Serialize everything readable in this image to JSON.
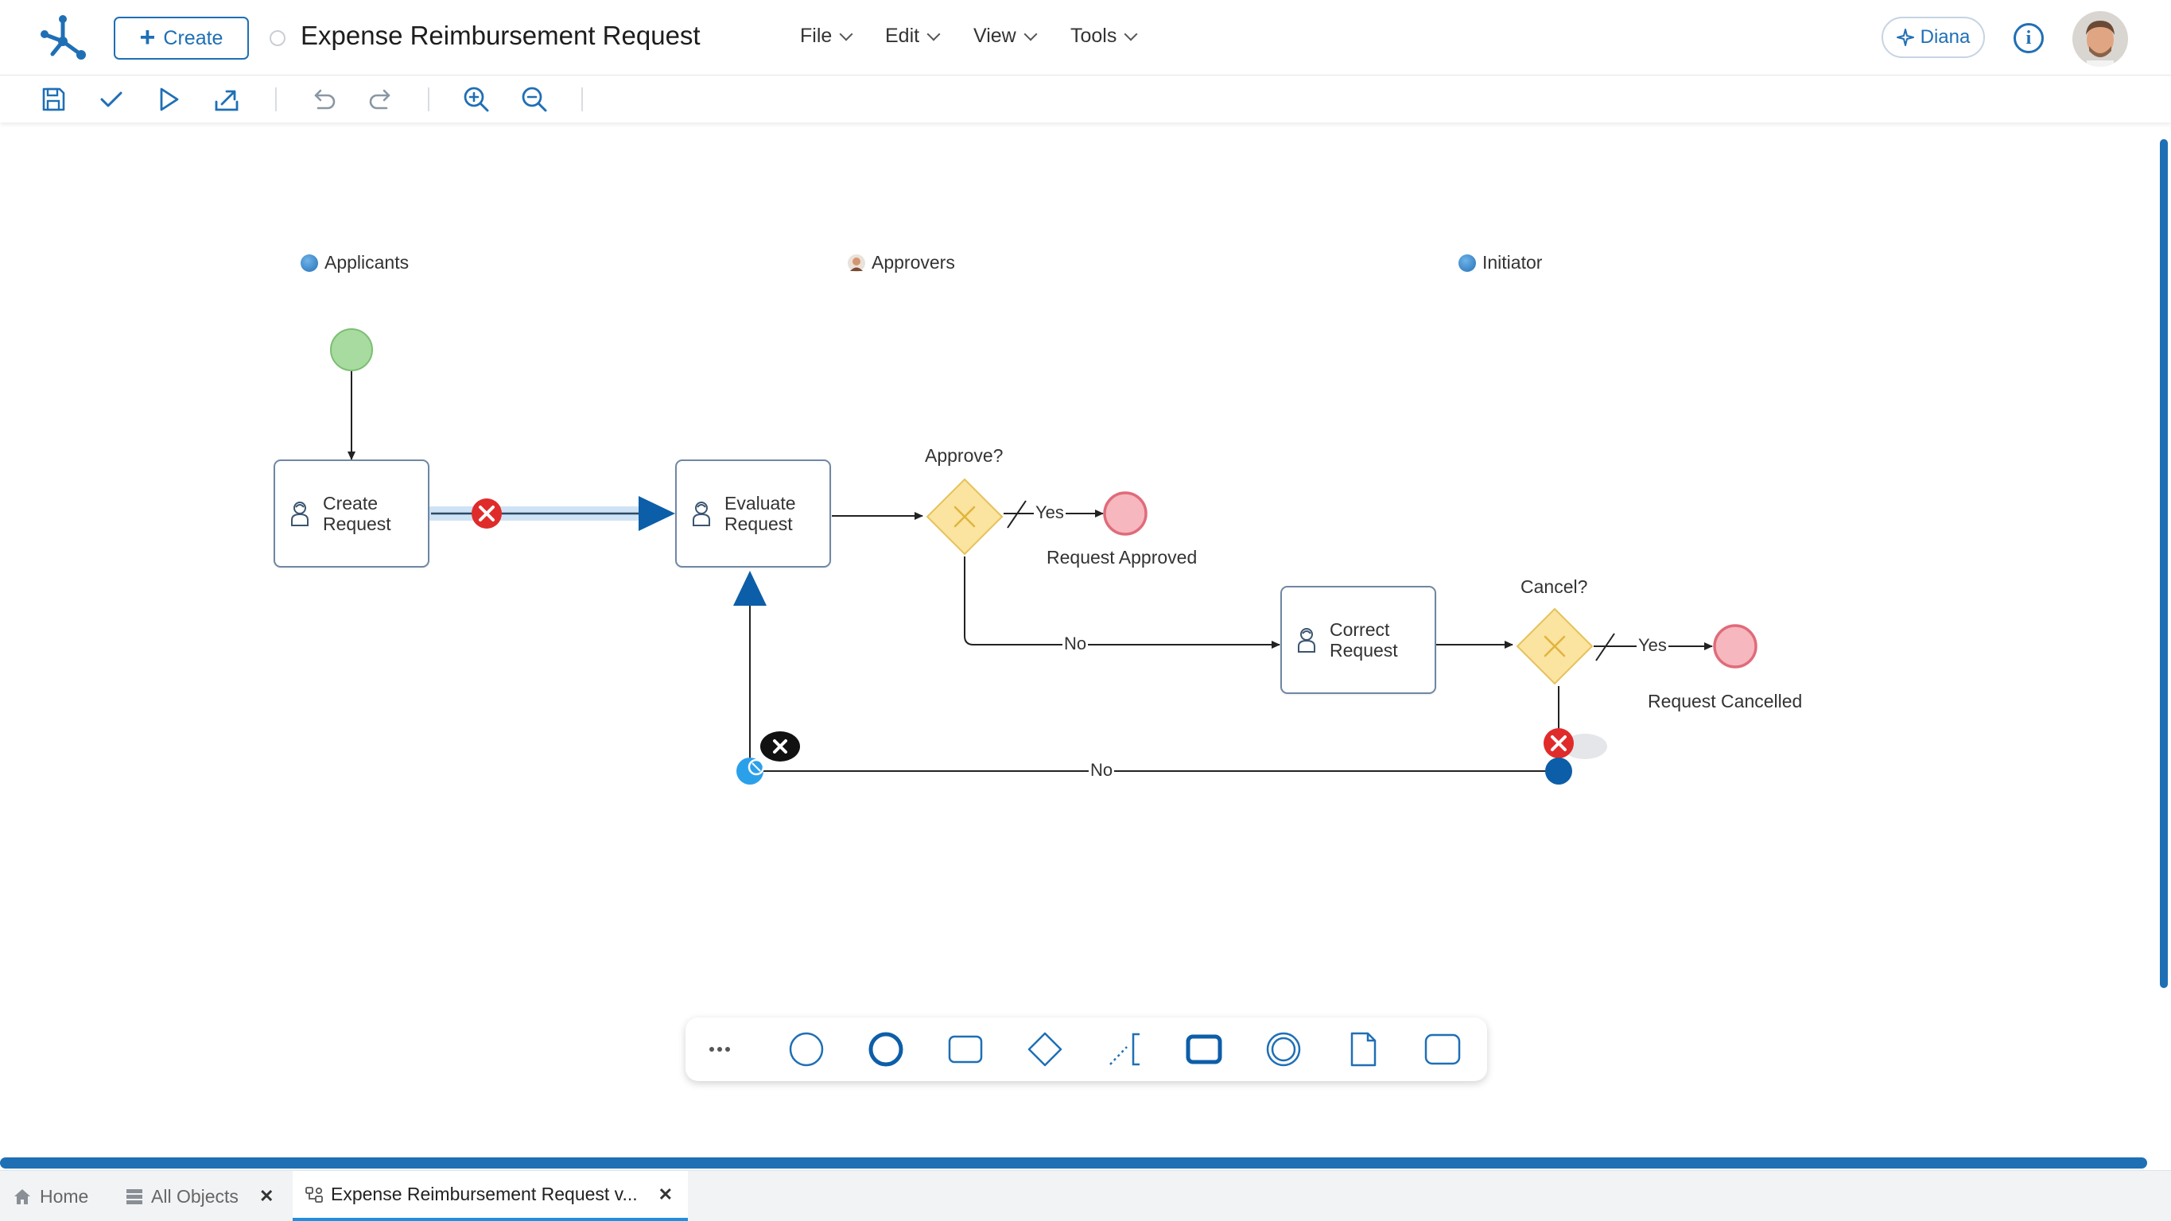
{
  "header": {
    "create_label": "Create",
    "title": "Expense Reimbursement Request",
    "menus": {
      "file": "File",
      "edit": "Edit",
      "view": "View",
      "tools": "Tools"
    },
    "assistant_label": "Diana",
    "colors": {
      "accent": "#1f6fb5"
    }
  },
  "toolbar": {
    "icons": [
      "save-icon",
      "check-icon",
      "play-icon",
      "export-icon",
      "undo-icon",
      "redo-icon",
      "zoom-in-icon",
      "zoom-out-icon"
    ]
  },
  "diagram": {
    "lanes": {
      "applicants": "Applicants",
      "approvers": "Approvers",
      "initiator": "Initiator"
    },
    "tasks": {
      "create": {
        "line1": "Create",
        "line2": "Request"
      },
      "evaluate": {
        "line1": "Evaluate",
        "line2": "Request"
      },
      "correct": {
        "line1": "Correct",
        "line2": "Request"
      }
    },
    "gateways": {
      "approve": "Approve?",
      "cancel": "Cancel?"
    },
    "end_events": {
      "approved": "Request Approved",
      "cancelled": "Request Cancelled"
    },
    "edges": {
      "approve_yes": "Yes",
      "approve_no": "No",
      "cancel_yes": "Yes",
      "cancel_no": "No"
    },
    "colors": {
      "start": "#a8dba0",
      "end": "#f6b7bf",
      "gateway": "#fbe3a0",
      "selected": "#0d5ea8"
    }
  },
  "palette": {
    "items": [
      "more-icon",
      "start-event-icon",
      "end-event-icon",
      "task-icon",
      "gateway-icon",
      "association-icon",
      "subprocess-icon",
      "intermediate-event-icon",
      "data-object-icon",
      "group-icon"
    ]
  },
  "tabs": {
    "home": "Home",
    "all_objects": "All Objects",
    "active": "Expense Reimbursement Request v..."
  }
}
